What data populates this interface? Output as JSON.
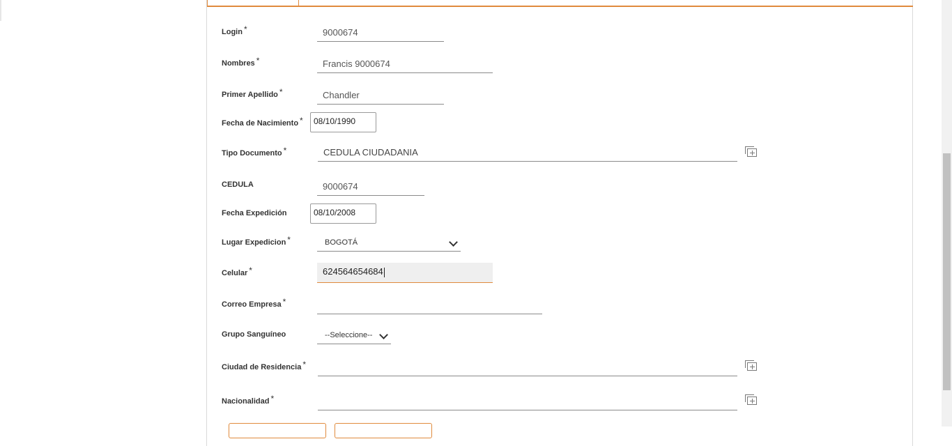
{
  "form": {
    "fields": {
      "login": {
        "label": "Login",
        "required": "*",
        "value": "9000674"
      },
      "nombres": {
        "label": "Nombres",
        "required": "*",
        "value": "Francis 9000674"
      },
      "primer_apellido": {
        "label": "Primer Apellido",
        "required": "*",
        "value": "Chandler"
      },
      "fecha_nacimiento": {
        "label": "Fecha de Nacimiento",
        "required": "*",
        "value": "08/10/1990"
      },
      "tipo_documento": {
        "label": "Tipo Documento",
        "required": "*",
        "value": "CEDULA CIUDADANIA"
      },
      "cedula": {
        "label": "CEDULA",
        "value": "9000674"
      },
      "fecha_expedicion": {
        "label": "Fecha Expedición",
        "value": "08/10/2008"
      },
      "lugar_expedicion": {
        "label": "Lugar Expedicion",
        "required": "*",
        "value": "BOGOTÁ"
      },
      "celular": {
        "label": "Celular",
        "required": "*",
        "value": "624564654684"
      },
      "correo_empresa": {
        "label": "Correo Empresa",
        "required": "*",
        "value": ""
      },
      "grupo_sanguineo": {
        "label": "Grupo Sanguíneo",
        "value": "--Seleccione--"
      },
      "ciudad_residencia": {
        "label": "Ciudad de Residencia",
        "required": "*",
        "value": ""
      },
      "nacionalidad": {
        "label": "Nacionalidad",
        "required": "*",
        "value": ""
      }
    }
  },
  "colors": {
    "accent": "#e08a3c"
  }
}
